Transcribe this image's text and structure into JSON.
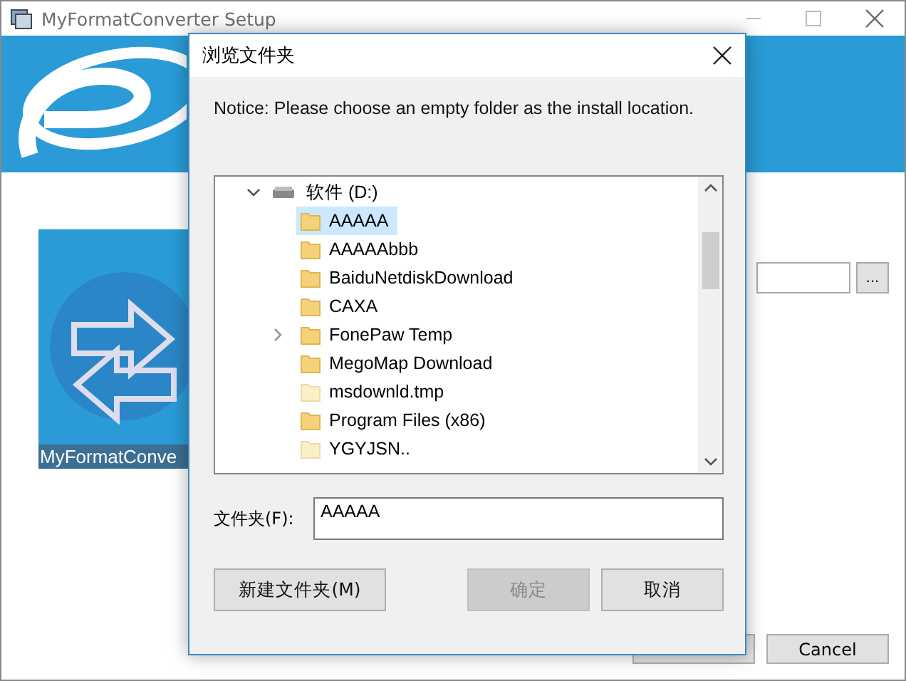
{
  "window": {
    "title": "MyFormatConverter Setup",
    "logo_caption": "MyFormatConve",
    "browse_button": "...",
    "buttons": [
      {
        "kind": "ok"
      },
      {
        "kind": "cancel",
        "label": "Cancel"
      }
    ]
  },
  "dialog": {
    "title": "浏览文件夹",
    "notice": "Notice: Please choose an empty folder as the install location.",
    "tree": [
      {
        "name": "软件 (D:)",
        "kind": "drive",
        "expanded": true,
        "selected": false,
        "children": [
          {
            "name": "AAAAA",
            "selected": true,
            "expandable": false,
            "hidden": false
          },
          {
            "name": "AAAAAbbb",
            "selected": false,
            "expandable": false,
            "hidden": false
          },
          {
            "name": "BaiduNetdiskDownload",
            "selected": false,
            "expandable": false,
            "hidden": false
          },
          {
            "name": "CAXA",
            "selected": false,
            "expandable": false,
            "hidden": false
          },
          {
            "name": "FonePaw Temp",
            "selected": false,
            "expandable": true,
            "hidden": false
          },
          {
            "name": "MegoMap Download",
            "selected": false,
            "expandable": false,
            "hidden": false
          },
          {
            "name": "msdownld.tmp",
            "selected": false,
            "expandable": false,
            "hidden": true
          },
          {
            "name": "Program Files (x86)",
            "selected": false,
            "expandable": false,
            "hidden": false
          },
          {
            "name": "YGYJSN..",
            "selected": false,
            "expandable": false,
            "hidden": true
          }
        ]
      }
    ],
    "folder_label": "文件夹(F):",
    "folder_value": "AAAAA",
    "buttons": [
      {
        "label": "新建文件夹(M)",
        "disabled": false
      },
      {
        "label": "确定",
        "disabled": true
      },
      {
        "label": "取消",
        "disabled": false
      }
    ]
  }
}
